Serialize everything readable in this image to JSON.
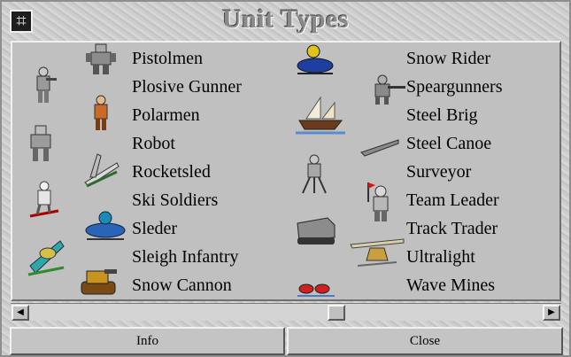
{
  "window": {
    "title": "Unit Types"
  },
  "units": {
    "left": [
      "Pistolmen",
      "Plosive Gunner",
      "Polarmen",
      "Robot",
      "Rocketsled",
      "Ski Soldiers",
      "Sleder",
      "Sleigh Infantry",
      "Snow Cannon"
    ],
    "right": [
      "Snow Rider",
      "Speargunners",
      "Steel Brig",
      "Steel Canoe",
      "Surveyor",
      "Team Leader",
      "Track Trader",
      "Ultralight",
      "Wave Mines"
    ]
  },
  "scrollbar": {
    "left_icon": "scroll-left-arrow-icon",
    "right_icon": "scroll-right-arrow-icon"
  },
  "buttons": {
    "info": "Info",
    "close": "Close"
  }
}
